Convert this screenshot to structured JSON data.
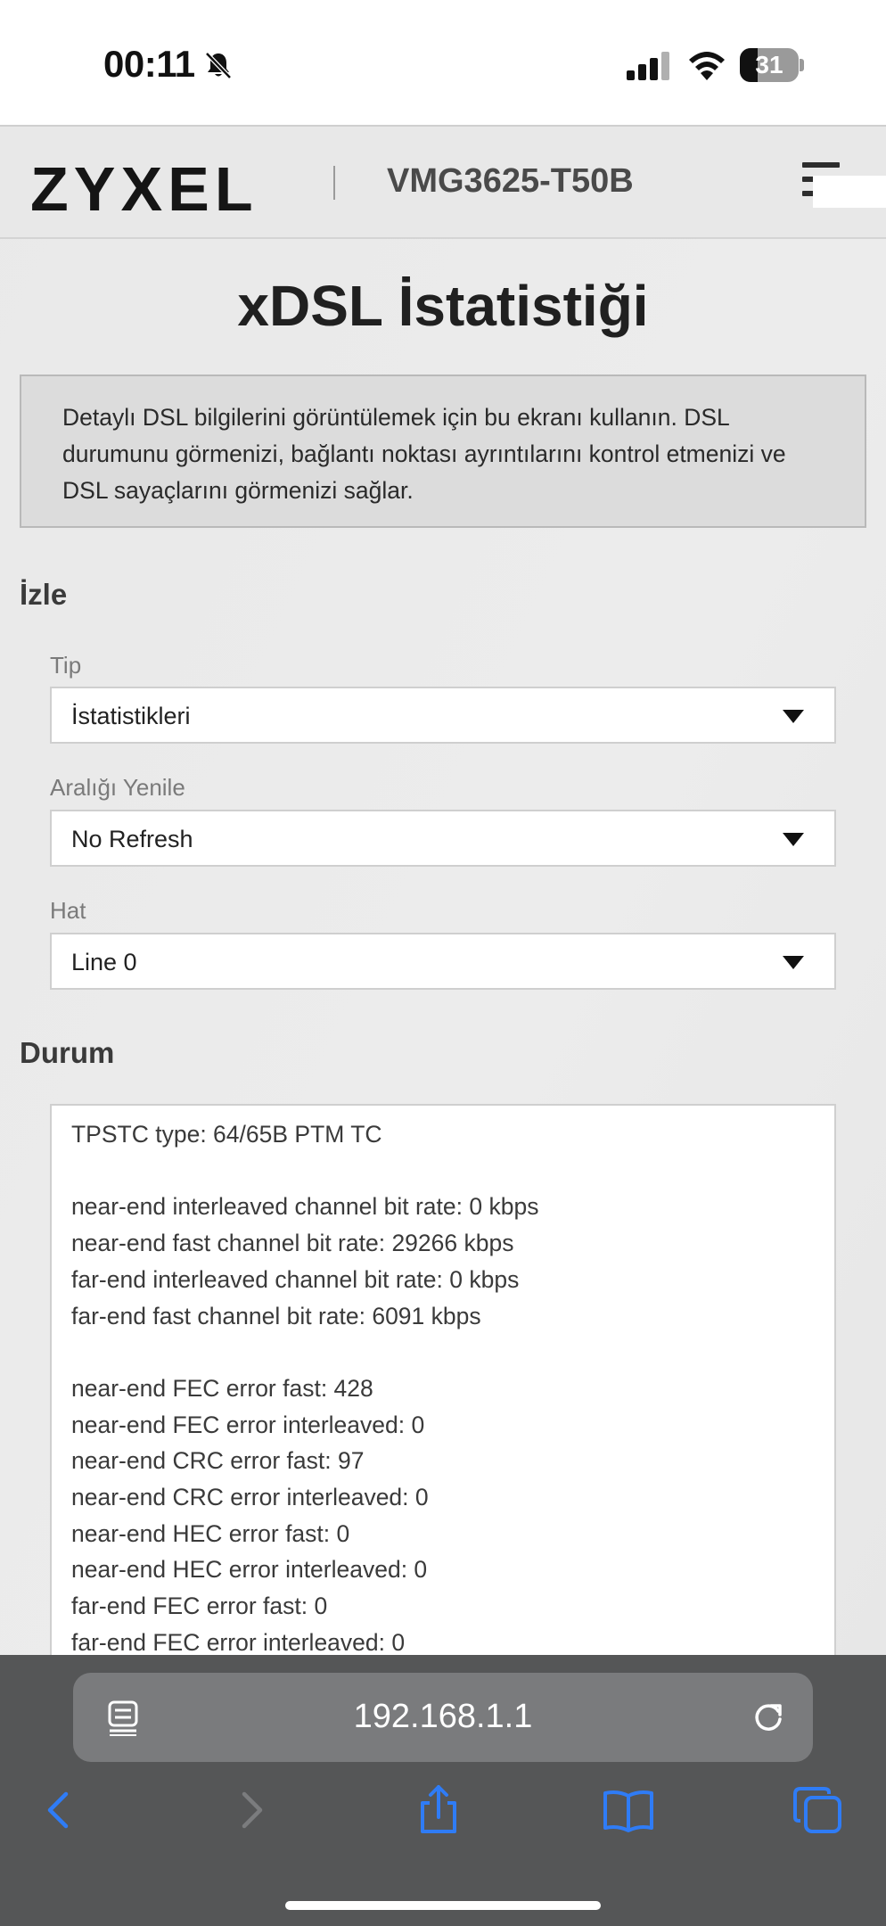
{
  "status_bar": {
    "time": "00:11",
    "battery_level": "31",
    "battery_fraction": 0.31
  },
  "header": {
    "logo": "ZYXEL",
    "model": "VMG3625-T50B"
  },
  "page": {
    "title": "xDSL İstatistiği",
    "description": "Detaylı DSL bilgilerini görüntülemek için bu ekranı kullanın. DSL durumunu görmenizi, bağlantı noktası ayrıntılarını kontrol etmenizi ve DSL sayaçlarını görmenizi sağlar."
  },
  "monitor": {
    "section_title": "İzle",
    "type_label": "Tip",
    "type_value": "İstatistikleri",
    "refresh_label": "Aralığı Yenile",
    "refresh_value": "No Refresh",
    "line_label": "Hat",
    "line_value": "Line 0"
  },
  "status": {
    "section_title": "Durum",
    "lines": [
      "TPSTC type: 64/65B PTM TC",
      "",
      "near-end interleaved channel bit rate: 0 kbps",
      "near-end fast channel bit rate: 29266 kbps",
      "far-end interleaved channel bit rate: 0 kbps",
      "far-end fast channel bit rate: 6091 kbps",
      "",
      "near-end FEC error fast: 428",
      "near-end FEC error interleaved: 0",
      "near-end CRC error fast: 97",
      "near-end CRC error interleaved: 0",
      "near-end HEC error fast: 0",
      "near-end HEC error interleaved: 0",
      "far-end FEC error fast: 0",
      "far-end FEC error interleaved: 0"
    ]
  },
  "browser": {
    "url": "192.168.1.1",
    "icons": [
      "reader-icon",
      "reload-icon",
      "back-icon",
      "forward-icon",
      "share-icon",
      "bookmarks-icon",
      "tabs-icon"
    ],
    "accent_color": "#2f7cf6"
  }
}
